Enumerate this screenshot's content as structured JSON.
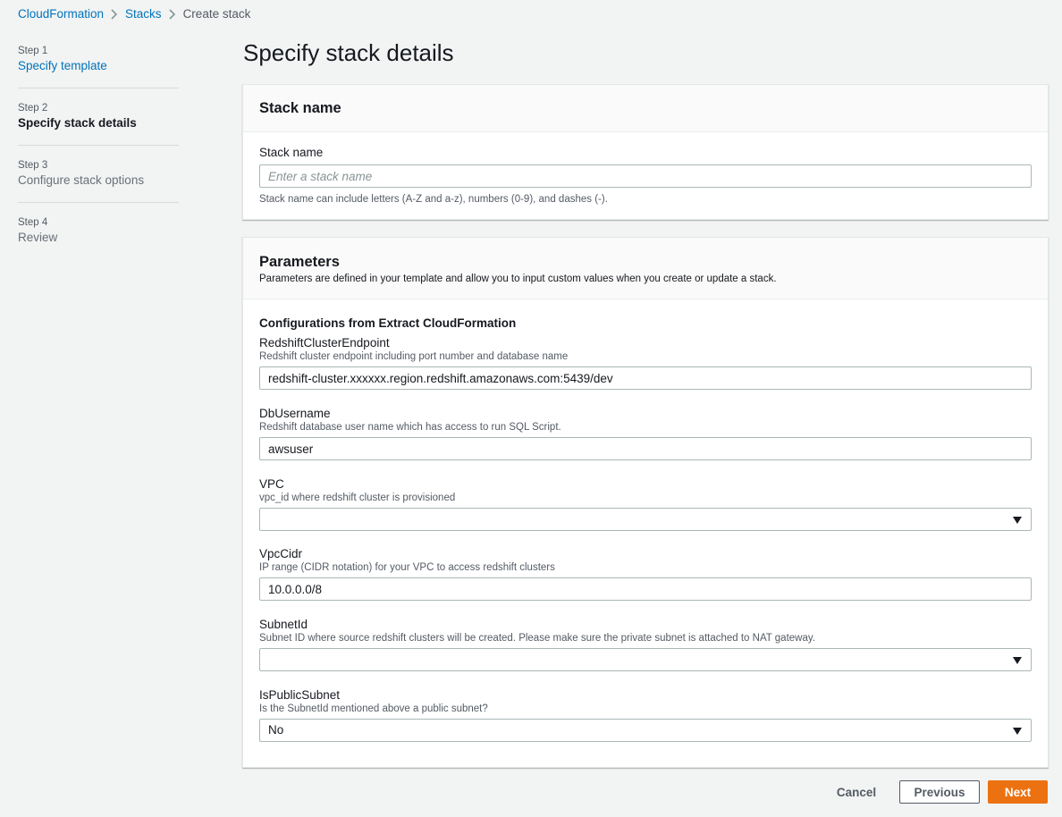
{
  "breadcrumb": {
    "items": [
      "CloudFormation",
      "Stacks"
    ],
    "current": "Create stack"
  },
  "steps": [
    {
      "num": "Step 1",
      "title": "Specify template"
    },
    {
      "num": "Step 2",
      "title": "Specify stack details"
    },
    {
      "num": "Step 3",
      "title": "Configure stack options"
    },
    {
      "num": "Step 4",
      "title": "Review"
    }
  ],
  "page_title": "Specify stack details",
  "stack_name_panel": {
    "title": "Stack name",
    "label": "Stack name",
    "placeholder": "Enter a stack name",
    "value": "",
    "hint": "Stack name can include letters (A-Z and a-z), numbers (0-9), and dashes (-)."
  },
  "parameters_panel": {
    "title": "Parameters",
    "description": "Parameters are defined in your template and allow you to input custom values when you create or update a stack.",
    "group_title": "Configurations from Extract CloudFormation",
    "fields": [
      {
        "label": "RedshiftClusterEndpoint",
        "desc": "Redshift cluster endpoint including port number and database name",
        "value": "redshift-cluster.xxxxxx.region.redshift.amazonaws.com:5439/dev"
      },
      {
        "label": "DbUsername",
        "desc": "Redshift database user name which has access to run SQL Script.",
        "value": "awsuser"
      },
      {
        "label": "VPC",
        "desc": "vpc_id where redshift cluster is provisioned",
        "value": ""
      },
      {
        "label": "VpcCidr",
        "desc": "IP range (CIDR notation) for your VPC to access redshift clusters",
        "value": "10.0.0.0/8"
      },
      {
        "label": "SubnetId",
        "desc": "Subnet ID where source redshift clusters will be created. Please make sure the private subnet is attached to NAT gateway.",
        "value": ""
      },
      {
        "label": "IsPublicSubnet",
        "desc": "Is the SubnetId mentioned above a public subnet?",
        "value": "No"
      }
    ]
  },
  "footer": {
    "cancel_label": "Cancel",
    "previous_label": "Previous",
    "next_label": "Next"
  },
  "colors": {
    "link": "#0073bb",
    "primary_button": "#ec7211",
    "background": "#f2f3f3"
  }
}
